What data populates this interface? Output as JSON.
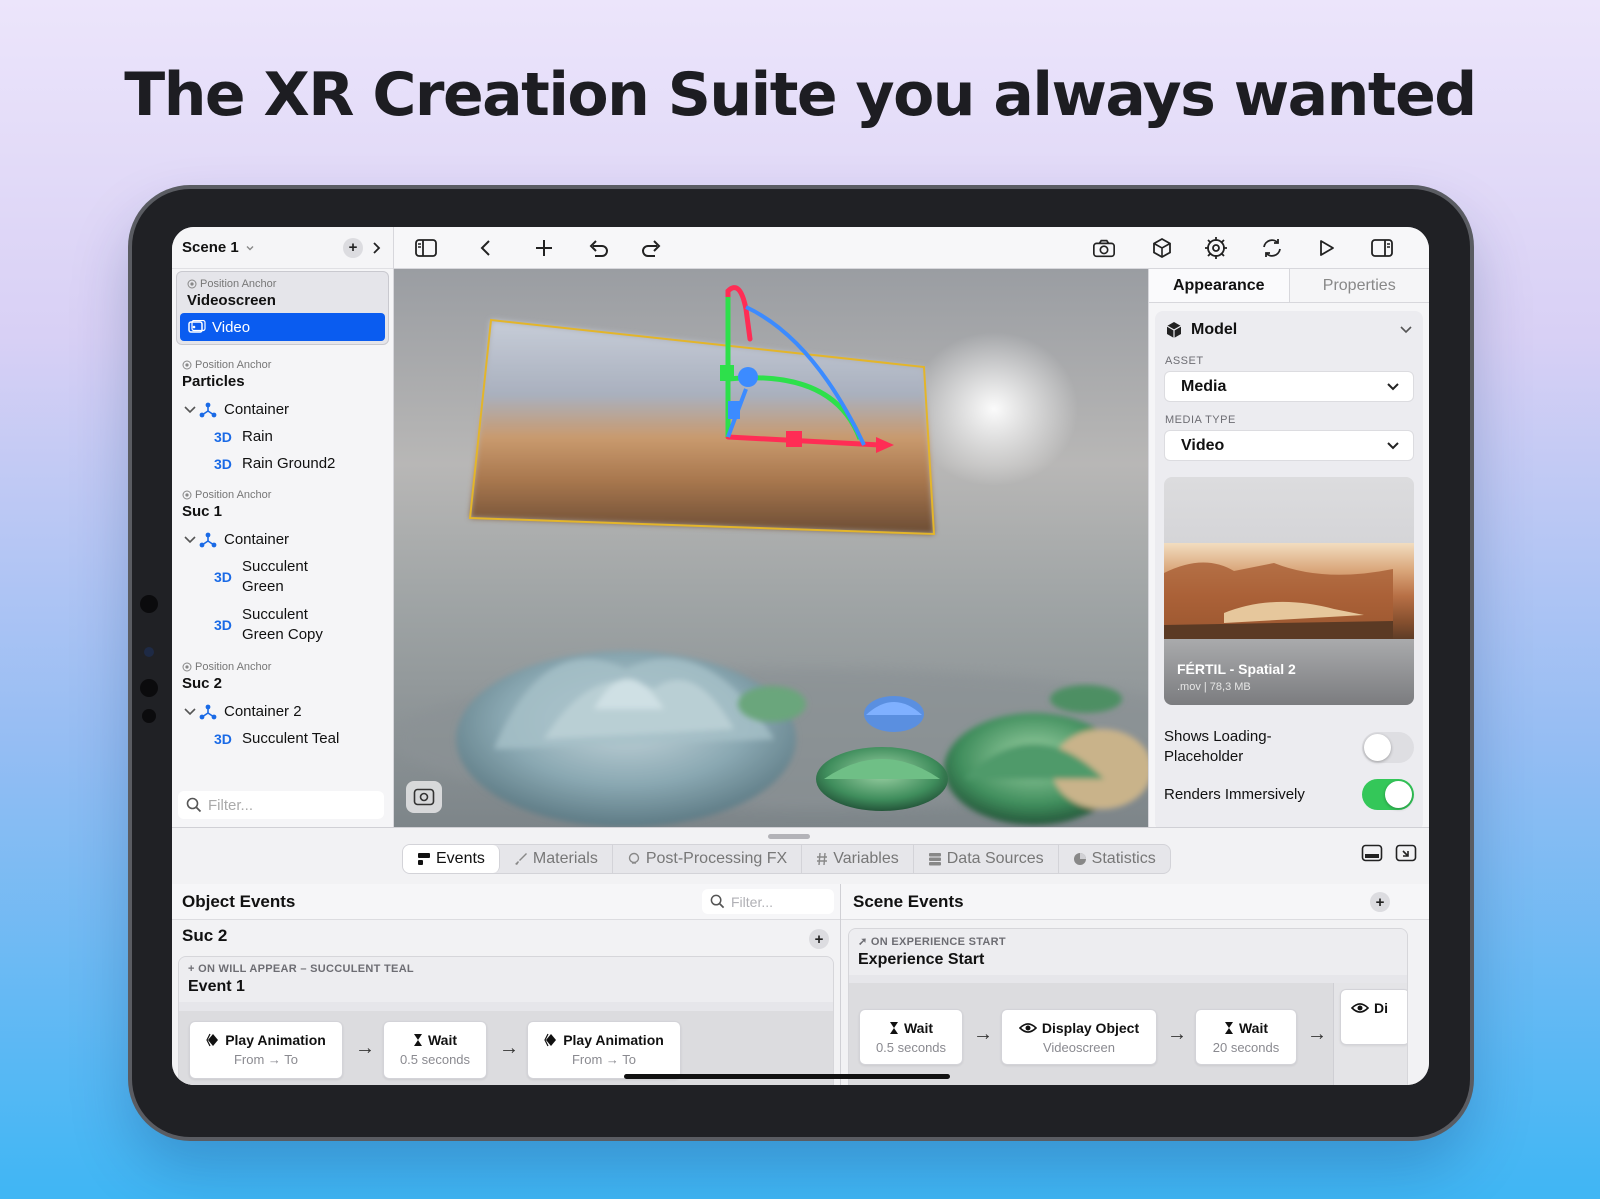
{
  "headline": "The XR Creation Suite you always wanted",
  "colors": {
    "accent": "#0a5cf0",
    "toggle_on": "#34c759",
    "gizmo_x": "#ff2d55",
    "gizmo_y": "#2de04b",
    "gizmo_z": "#3c8bff",
    "frame": "#e3b52a"
  },
  "scene": {
    "title": "Scene 1",
    "add_icon": "+",
    "expand_icon": "chevron-right"
  },
  "outline": {
    "anchor_label": "Position Anchor",
    "group1": {
      "name": "Videoscreen",
      "selected_item": "Video"
    },
    "group2": {
      "name": "Particles",
      "container": "Container",
      "items": [
        "Rain",
        "Rain Ground2"
      ]
    },
    "group3": {
      "name": "Suc 1",
      "container": "Container",
      "items": [
        [
          "Succulent",
          "Green"
        ],
        [
          "Succulent",
          "Green Copy"
        ]
      ]
    },
    "group4": {
      "name": "Suc 2",
      "container": "Container 2",
      "items": [
        "Succulent Teal"
      ]
    },
    "tag3d": "3D",
    "filter_placeholder": "Filter..."
  },
  "inspector": {
    "tabs": [
      "Appearance",
      "Properties"
    ],
    "section_title": "Model",
    "asset_label": "ASSET",
    "asset_value": "Media",
    "media_type_label": "MEDIA TYPE",
    "media_type_value": "Video",
    "thumb_title": "FÉRTIL - Spatial 2",
    "thumb_meta": ".mov | 78,3 MB",
    "toggle1": {
      "label1": "Shows Loading-",
      "label2": "Placeholder",
      "on": false
    },
    "toggle2": {
      "label": "Renders Immersively",
      "on": true
    }
  },
  "bottom_tabs": [
    "Events",
    "Materials",
    "Post-Processing FX",
    "Variables",
    "Data Sources",
    "Statistics"
  ],
  "object_events": {
    "title": "Object Events",
    "filter_placeholder": "Filter...",
    "object_name": "Suc 2",
    "event_tag": "ON WILL APPEAR – SUCCULENT TEAL",
    "event_name": "Event 1",
    "steps": [
      {
        "action": "Play Animation",
        "detail": "From → To"
      },
      {
        "action": "Wait",
        "detail": "0.5 seconds"
      },
      {
        "action": "Play Animation",
        "detail": "From → To"
      }
    ]
  },
  "scene_events": {
    "title": "Scene Events",
    "event_tag": "ON EXPERIENCE START",
    "event_name": "Experience Start",
    "steps": [
      {
        "action": "Wait",
        "detail": "0.5 seconds"
      },
      {
        "action": "Display Object",
        "detail": "Videoscreen"
      },
      {
        "action": "Wait",
        "detail": "20 seconds"
      },
      {
        "action": "Di",
        "detail": ""
      }
    ]
  }
}
